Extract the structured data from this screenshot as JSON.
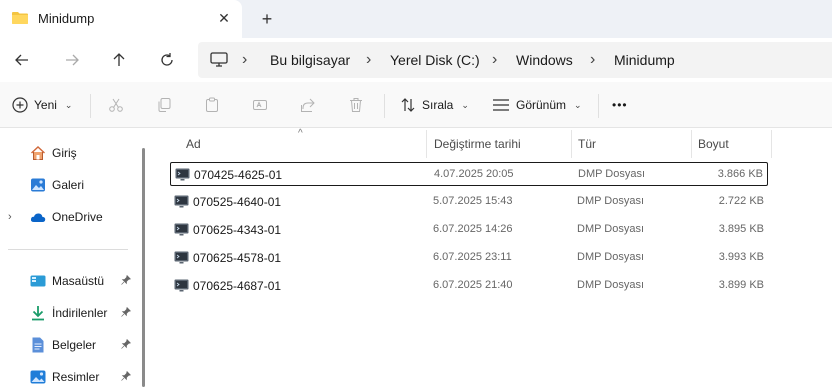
{
  "window": {
    "tab_title": "Minidump",
    "new_tab": "+",
    "close": "✕"
  },
  "breadcrumb": [
    "Bu bilgisayar",
    "Yerel Disk (C:)",
    "Windows",
    "Minidump"
  ],
  "breadcrumb_separator": "›",
  "toolbar": {
    "new_label": "Yeni",
    "sort_label": "Sırala",
    "view_label": "Görünüm",
    "more_label": "•••",
    "chevron": "⌄"
  },
  "sidebar": {
    "items": [
      {
        "label": "Giriş",
        "icon": "home-icon"
      },
      {
        "label": "Galeri",
        "icon": "gallery-icon"
      },
      {
        "label": "OneDrive",
        "icon": "onedrive-icon",
        "expandable": true
      }
    ],
    "pinned": [
      {
        "label": "Masaüstü",
        "icon": "desktop-icon"
      },
      {
        "label": "İndirilenler",
        "icon": "downloads-icon"
      },
      {
        "label": "Belgeler",
        "icon": "documents-icon"
      },
      {
        "label": "Resimler",
        "icon": "pictures-icon"
      }
    ],
    "expand_glyph": "›",
    "pin_glyph": "📌"
  },
  "columns": {
    "name": "Ad",
    "date": "Değiştirme tarihi",
    "type": "Tür",
    "size": "Boyut",
    "sort_indicator": "^"
  },
  "files": [
    {
      "name": "070425-4625-01",
      "date": "4.07.2025 20:05",
      "type": "DMP Dosyası",
      "size": "3.866 KB",
      "selected": true
    },
    {
      "name": "070525-4640-01",
      "date": "5.07.2025 15:43",
      "type": "DMP Dosyası",
      "size": "2.722 KB",
      "selected": false
    },
    {
      "name": "070625-4343-01",
      "date": "6.07.2025 14:26",
      "type": "DMP Dosyası",
      "size": "3.895 KB",
      "selected": false
    },
    {
      "name": "070625-4578-01",
      "date": "6.07.2025 23:11",
      "type": "DMP Dosyası",
      "size": "3.993 KB",
      "selected": false
    },
    {
      "name": "070625-4687-01",
      "date": "6.07.2025 21:40",
      "type": "DMP Dosyası",
      "size": "3.899 KB",
      "selected": false
    }
  ],
  "colors": {
    "accent": "#0067c0",
    "folder": "#f4c542",
    "selection_border": "#1a1a1a"
  }
}
